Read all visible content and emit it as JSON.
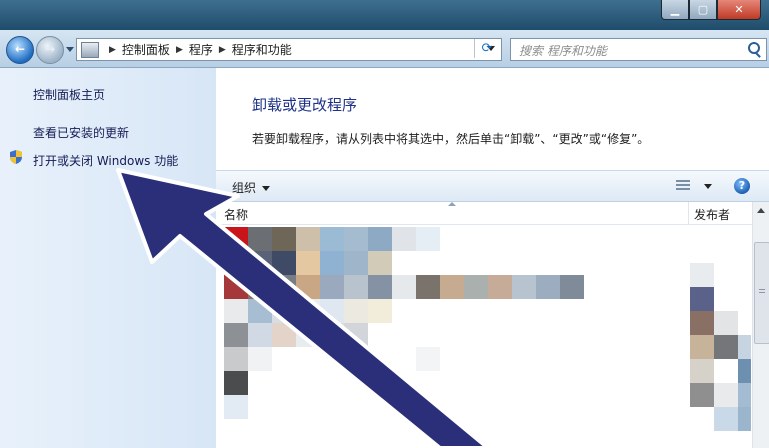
{
  "breadcrumb": [
    "控制面板",
    "程序",
    "程序和功能"
  ],
  "search": {
    "placeholder": "搜索 程序和功能"
  },
  "sidebar": {
    "items": [
      {
        "label": "控制面板主页"
      },
      {
        "label": "查看已安装的更新"
      },
      {
        "label": "打开或关闭 Windows 功能"
      }
    ]
  },
  "main": {
    "title": "卸载或更改程序",
    "description": "若要卸载程序，请从列表中将其选中，然后单击“卸载”、“更改”或“修复”。"
  },
  "toolbar": {
    "organize_label": "组织"
  },
  "table": {
    "headers": [
      "名称",
      "发布者"
    ]
  },
  "colors": {
    "sidebar_bg": "#dce9f7",
    "link": "#151c55",
    "title": "#1e3287",
    "arrow_fill": "#2b2f7a",
    "arrow_outline": "#ffffff"
  }
}
